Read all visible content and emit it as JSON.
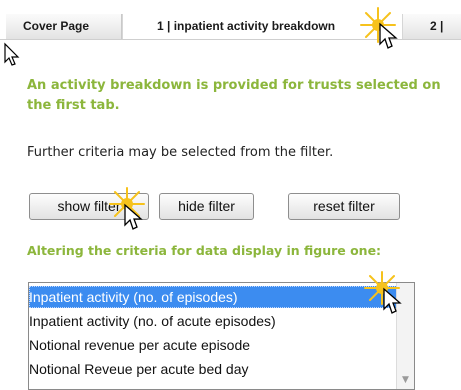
{
  "tabs": [
    {
      "label": "Cover Page",
      "active": false
    },
    {
      "label": "1 | inpatient activity breakdown",
      "active": true
    },
    {
      "label": "2 |",
      "active": false
    }
  ],
  "intro_note": "An activity breakdown is provided for trusts selected on the first tab.",
  "filter_note": "Further criteria may be selected from the filter.",
  "buttons": {
    "show_filter": "show filter",
    "hide_filter": "hide filter",
    "reset_filter": "reset filter"
  },
  "criteria_heading": "Altering the criteria for data display in figure one:",
  "criteria_options": [
    {
      "label": "Inpatient activity (no. of episodes)",
      "selected": true
    },
    {
      "label": "Inpatient activity (no. of acute episodes)",
      "selected": false
    },
    {
      "label": "Notional revenue per acute episode",
      "selected": false
    },
    {
      "label": "Notional Reveue per acute bed day",
      "selected": false
    }
  ],
  "colors": {
    "accent_green": "#8cb63c",
    "selection_blue": "#3c8cf0",
    "highlight_yellow": "#f6c21c"
  },
  "icons": [
    "arrow-cursor-icon",
    "click-sparkle-icon",
    "chevron-down-icon"
  ]
}
